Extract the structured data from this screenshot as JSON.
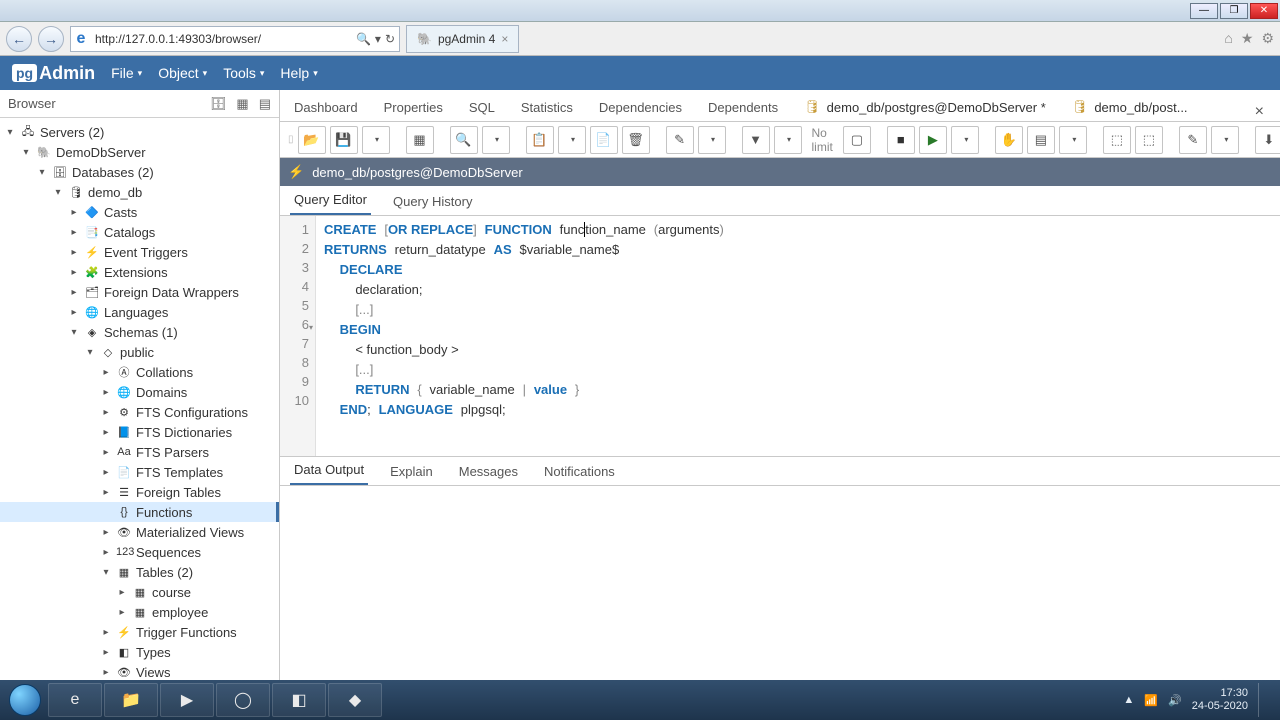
{
  "window": {
    "minimize": "—",
    "maximize": "❐",
    "close": "✕"
  },
  "ie": {
    "url": "http://127.0.0.1:49303/browser/",
    "tab_title": "pgAdmin 4",
    "search_icon": "🔍",
    "refresh_icon": "↻",
    "right_icons": [
      "⌂",
      "★",
      "⚙"
    ]
  },
  "pg_menu": {
    "logo_box": "pg",
    "logo_text": "Admin",
    "items": [
      "File",
      "Object",
      "Tools",
      "Help"
    ]
  },
  "browser": {
    "title": "Browser",
    "tree": [
      {
        "indent": 0,
        "exp": "▾",
        "icon": "🖧",
        "label": "Servers (2)"
      },
      {
        "indent": 1,
        "exp": "▾",
        "icon": "🐘",
        "label": "DemoDbServer"
      },
      {
        "indent": 2,
        "exp": "▾",
        "icon": "🗄",
        "label": "Databases (2)"
      },
      {
        "indent": 3,
        "exp": "▾",
        "icon": "🛢",
        "label": "demo_db"
      },
      {
        "indent": 4,
        "exp": "▸",
        "icon": "🔷",
        "label": "Casts"
      },
      {
        "indent": 4,
        "exp": "▸",
        "icon": "📑",
        "label": "Catalogs"
      },
      {
        "indent": 4,
        "exp": "▸",
        "icon": "⚡",
        "label": "Event Triggers"
      },
      {
        "indent": 4,
        "exp": "▸",
        "icon": "🧩",
        "label": "Extensions"
      },
      {
        "indent": 4,
        "exp": "▸",
        "icon": "🗂",
        "label": "Foreign Data Wrappers"
      },
      {
        "indent": 4,
        "exp": "▸",
        "icon": "🌐",
        "label": "Languages"
      },
      {
        "indent": 4,
        "exp": "▾",
        "icon": "◈",
        "label": "Schemas (1)"
      },
      {
        "indent": 5,
        "exp": "▾",
        "icon": "◇",
        "label": "public"
      },
      {
        "indent": 6,
        "exp": "▸",
        "icon": "Ⓐ",
        "label": "Collations"
      },
      {
        "indent": 6,
        "exp": "▸",
        "icon": "🌐",
        "label": "Domains"
      },
      {
        "indent": 6,
        "exp": "▸",
        "icon": "⚙",
        "label": "FTS Configurations"
      },
      {
        "indent": 6,
        "exp": "▸",
        "icon": "📘",
        "label": "FTS Dictionaries"
      },
      {
        "indent": 6,
        "exp": "▸",
        "icon": "Aa",
        "label": "FTS Parsers"
      },
      {
        "indent": 6,
        "exp": "▸",
        "icon": "📄",
        "label": "FTS Templates"
      },
      {
        "indent": 6,
        "exp": "▸",
        "icon": "☰",
        "label": "Foreign Tables"
      },
      {
        "indent": 6,
        "exp": "",
        "icon": "{}",
        "label": "Functions",
        "selected": true
      },
      {
        "indent": 6,
        "exp": "▸",
        "icon": "👁",
        "label": "Materialized Views"
      },
      {
        "indent": 6,
        "exp": "▸",
        "icon": "123",
        "label": "Sequences"
      },
      {
        "indent": 6,
        "exp": "▾",
        "icon": "▦",
        "label": "Tables (2)"
      },
      {
        "indent": 7,
        "exp": "▸",
        "icon": "▦",
        "label": "course"
      },
      {
        "indent": 7,
        "exp": "▸",
        "icon": "▦",
        "label": "employee"
      },
      {
        "indent": 6,
        "exp": "▸",
        "icon": "⚡",
        "label": "Trigger Functions"
      },
      {
        "indent": 6,
        "exp": "▸",
        "icon": "◧",
        "label": "Types"
      },
      {
        "indent": 6,
        "exp": "▸",
        "icon": "👁",
        "label": "Views"
      }
    ]
  },
  "content_tabs": {
    "items": [
      "Dashboard",
      "Properties",
      "SQL",
      "Statistics",
      "Dependencies",
      "Dependents"
    ],
    "db_tab_active": "demo_db/postgres@DemoDbServer *",
    "db_tab_other": "demo_db/post..."
  },
  "toolbar": {
    "no_limit": "No limit"
  },
  "connection": "demo_db/postgres@DemoDbServer",
  "editor_tabs": {
    "active": "Query Editor",
    "other": "Query History"
  },
  "code": {
    "lines": 10
  },
  "output_tabs": [
    "Data Output",
    "Explain",
    "Messages",
    "Notifications"
  ],
  "tray": {
    "time": "17:30",
    "date": "24-05-2020",
    "flag": "▲"
  }
}
